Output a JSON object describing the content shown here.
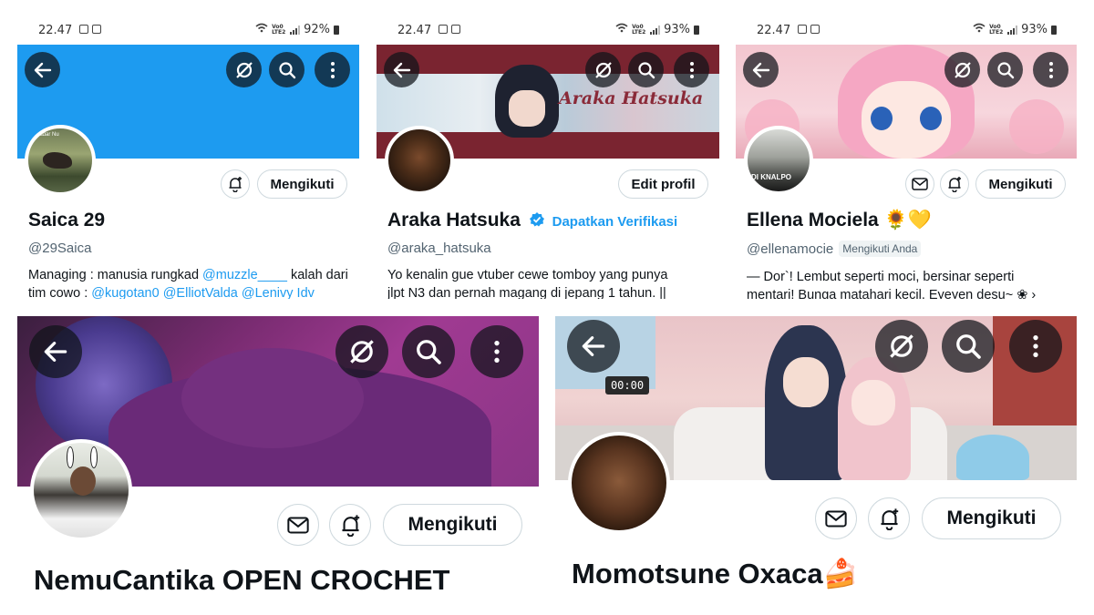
{
  "panels": [
    {
      "status": {
        "time": "22.47",
        "battery": "92%"
      },
      "name": "Saica 29",
      "handle": "@29Saica",
      "follow_label": "Mengikuti",
      "bio_line1_pre": "Managing : manusia rungkad ",
      "bio_line1_link": "@muzzle____",
      "bio_line1_post": " kalah dari",
      "bio_line2_pre": "tim cowo : ",
      "bio_line2_links": "@kugotan0 @ElliotValda @Lenivy Idv",
      "avatar_caption": "Radar Nu"
    },
    {
      "status": {
        "time": "22.47",
        "battery": "93%"
      },
      "name": "Araka Hatsuka",
      "verify_label": "Dapatkan Verifikasi",
      "handle": "@araka_hatsuka",
      "edit_label": "Edit profil",
      "bio_line1": "Yo kenalin gue vtuber cewe tomboy yang punya",
      "bio_line2": "jlpt N3 dan pernah magang di jepang 1 tahun. ||",
      "banner_text": "Araka Hatsuka"
    },
    {
      "status": {
        "time": "22.47",
        "battery": "93%"
      },
      "name": "Ellena Mociela 🌻💛",
      "handle": "@ellenamocie",
      "follows_you": "Mengikuti Anda",
      "follow_label": "Mengikuti",
      "bio_line1": "— Dor`!  Lembut seperti moci, bersinar seperti",
      "bio_line2": "mentari! Bunga matahari kecil. Eyeyen desu~ ❀ ›",
      "avatar_caption": "DI KNALPO"
    },
    {
      "name": "NemuCantika OPEN CROCHET",
      "follow_label": "Mengikuti"
    },
    {
      "name": "Momotsune Oxaca🍰",
      "follow_label": "Mengikuti",
      "clock": "00:00"
    }
  ],
  "colors": {
    "blue_banner": "#1d9bf0",
    "link": "#1d9bf0",
    "text": "#0f1419",
    "secondary": "#536471",
    "border": "#cfd9de"
  }
}
